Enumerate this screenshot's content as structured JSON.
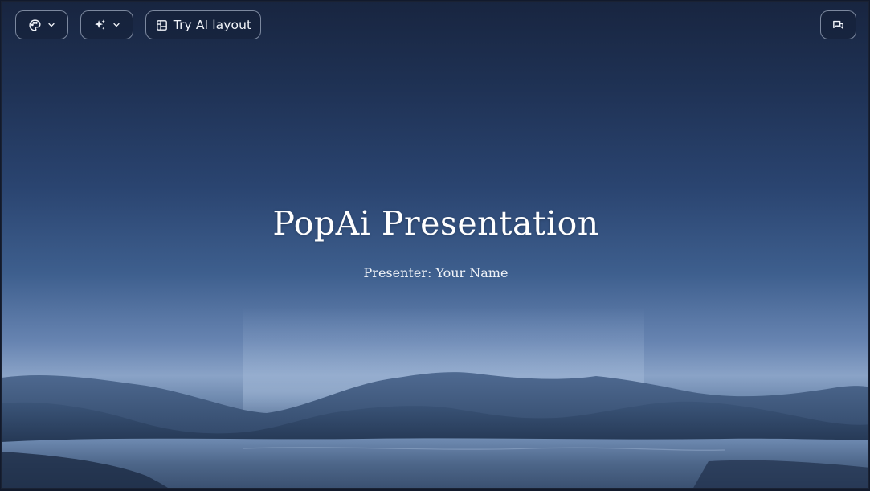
{
  "toolbar": {
    "theme_icon": "palette-icon",
    "ai_icon": "sparkle-icon",
    "layout_label": "Try AI layout",
    "layout_icon": "layout-icon",
    "comment_icon": "comment-icon"
  },
  "slide": {
    "title": "PopAi Presentation",
    "subtitle": "Presenter: Your Name"
  },
  "colors": {
    "sky_top": "#182540",
    "sky_horizon": "#8aa3c7",
    "text": "#ffffff"
  }
}
